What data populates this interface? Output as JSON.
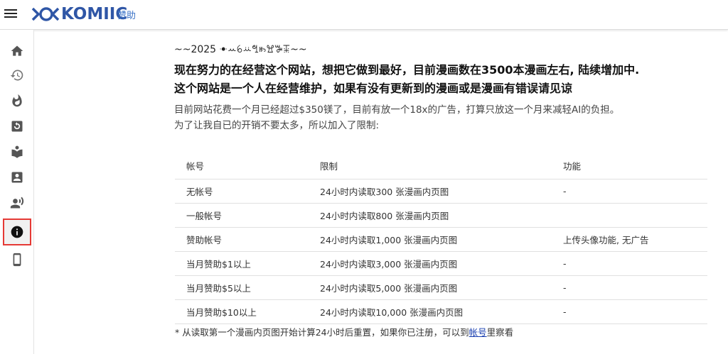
{
  "header": {
    "logo_text": "KOMIIC",
    "sponsor_link": "赞助"
  },
  "sidebar": {
    "items": [
      {
        "name": "home-icon"
      },
      {
        "name": "history-icon"
      },
      {
        "name": "fire-icon"
      },
      {
        "name": "refresh-icon"
      },
      {
        "name": "book-icon"
      },
      {
        "name": "account-box-icon"
      },
      {
        "name": "record-voice-icon"
      },
      {
        "name": "info-icon",
        "active": true
      },
      {
        "name": "phone-icon"
      }
    ],
    "active_color": "#e53935"
  },
  "main": {
    "year_line": "~~2025 ꔹꕀꕃꕁꔡꖳꖏꕅꔯ~~",
    "headline_1": "现在努力的在经营这个网站，想把它做到最好，目前漫画数在3500本漫画左右, 陆续增加中.",
    "headline_2": "这个网站是一个人在经营维护，如果有没有更新到的漫画或是漫画有错误请见谅",
    "para_1": "目前网站花费一个月已经超过$350镁了，目前有放一个18x的广告，打算只放这一个月来减轻AI的负担。",
    "para_2": "为了让我自已的开销不要太多，所以加入了限制:",
    "table": {
      "headers": [
        "帐号",
        "限制",
        "功能"
      ],
      "rows": [
        [
          "无帐号",
          "24小时内读取300 张漫画内页图",
          "-"
        ],
        [
          "一般帐号",
          "24小时内读取800 张漫画内页图",
          ""
        ],
        [
          "赞助帐号",
          "24小时内读取1,000 张漫画内页图",
          "上传头像功能, 无广告"
        ],
        [
          "当月赞助$1以上",
          "24小时内读取3,000 张漫画内页图",
          "-"
        ],
        [
          "当月赞助$5以上",
          "24小时内读取5,000 张漫画内页图",
          "-"
        ],
        [
          "当月赞助$10以上",
          "24小时内读取10,000 张漫画内页图",
          "-"
        ]
      ]
    },
    "note_prefix": "* 从读取第一个漫画内页图开始计算24小时后重置，如果你已注册，可以到",
    "note_link": "帐号",
    "note_suffix": "里察看"
  },
  "colors": {
    "brand": "#2f56a6",
    "link": "#3b73c7"
  }
}
